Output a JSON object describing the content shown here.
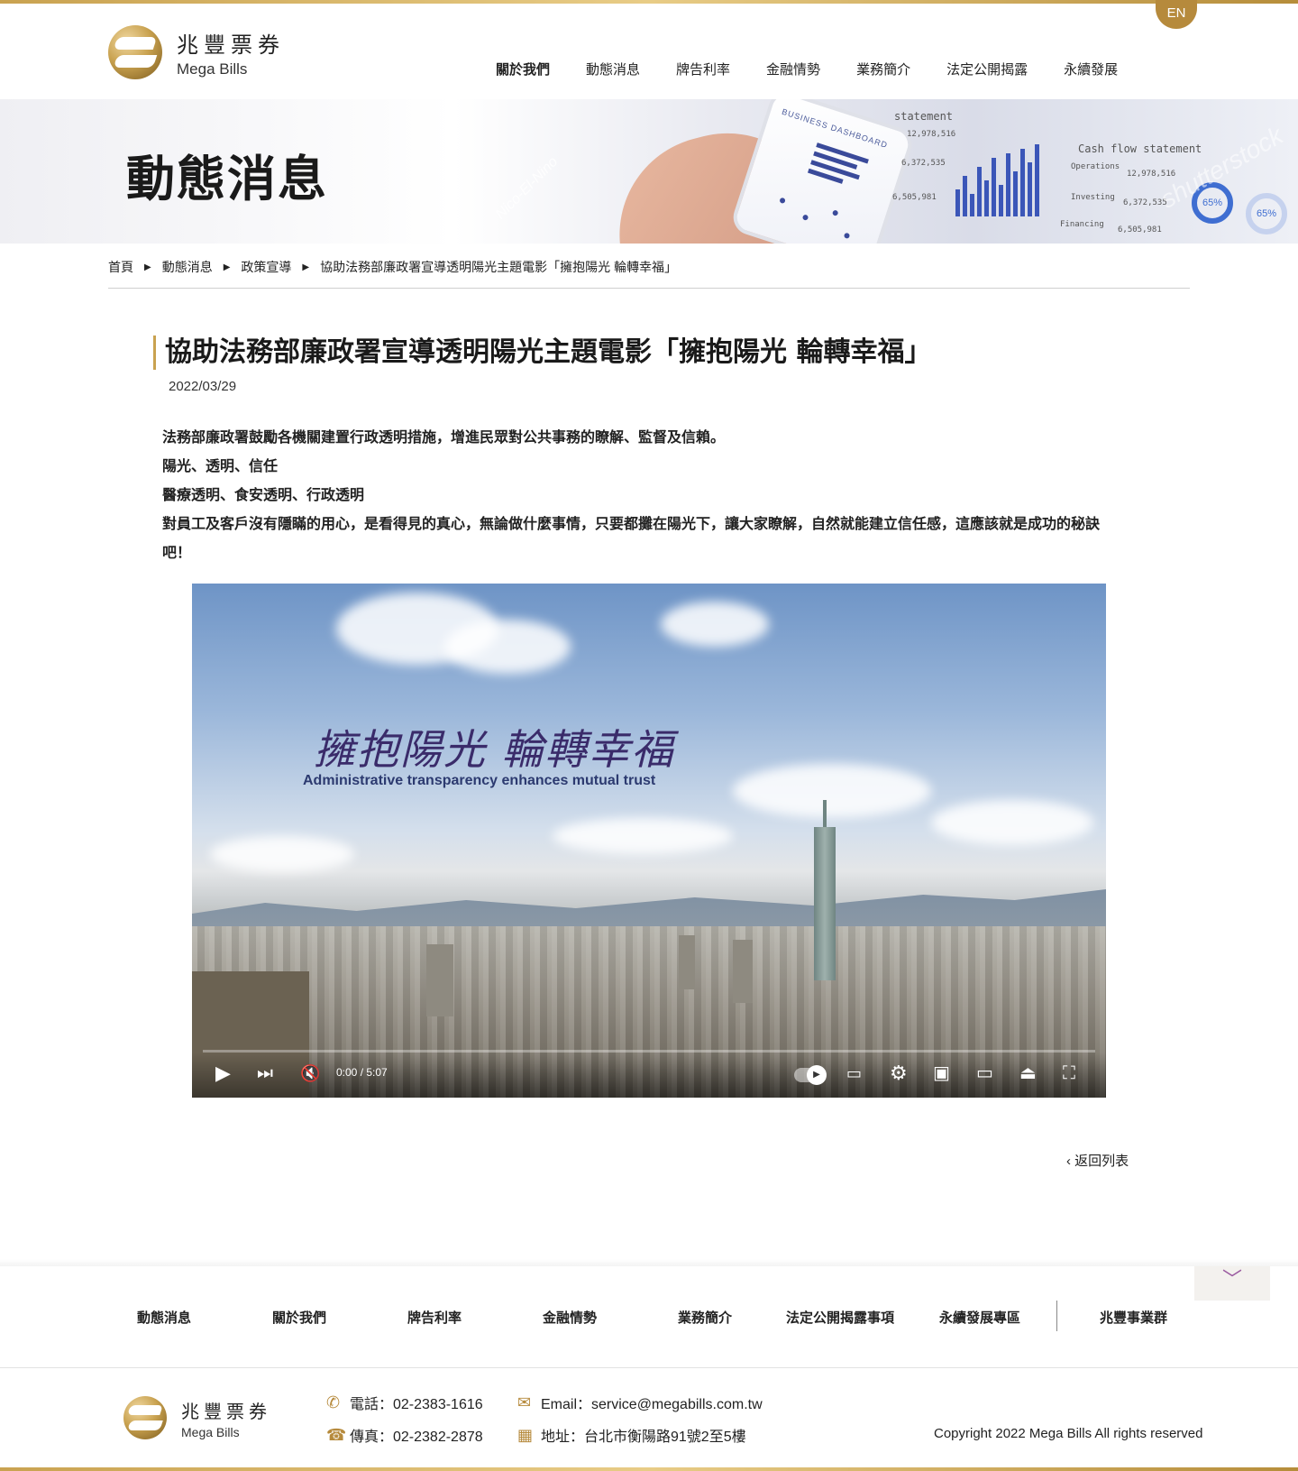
{
  "header": {
    "logo_zh": "兆豐票券",
    "logo_en": "Mega Bills",
    "lang_button": "EN",
    "nav": [
      {
        "label": "關於我們"
      },
      {
        "label": "動態消息"
      },
      {
        "label": "牌告利率"
      },
      {
        "label": "金融情勢"
      },
      {
        "label": "業務簡介"
      },
      {
        "label": "法定公開揭露"
      },
      {
        "label": "永續發展"
      }
    ]
  },
  "banner": {
    "title": "動態消息"
  },
  "breadcrumb": {
    "items": [
      "首頁",
      "動態消息",
      "政策宣導",
      "協助法務部廉政署宣導透明陽光主題電影「擁抱陽光 輪轉幸福」"
    ]
  },
  "article": {
    "title": "協助法務部廉政署宣導透明陽光主題電影「擁抱陽光 輪轉幸福」",
    "date": "2022/03/29",
    "paragraphs": [
      "法務部廉政署鼓勵各機關建置行政透明措施，增進民眾對公共事務的瞭解、監督及信賴。",
      "陽光、透明、信任",
      "醫療透明、食安透明、行政透明",
      "對員工及客戶沒有隱瞞的用心，是看得見的真心，無論做什麼事情，只要都攤在陽光下，讓大家瞭解，自然就能建立信任感，這應該就是成功的秘訣吧！"
    ]
  },
  "video": {
    "overlay_title": "擁抱陽光 輪轉幸福",
    "overlay_subtitle": "Administrative transparency enhances mutual trust",
    "time": "0:00 / 5:07",
    "icons": [
      "play-icon",
      "next-icon",
      "mute-icon",
      "autoplay-toggle",
      "subtitles-icon",
      "settings-icon",
      "miniplayer-icon",
      "theater-icon",
      "airplay-icon",
      "fullscreen-icon"
    ]
  },
  "back_link": "返回列表",
  "footer_nav": [
    {
      "label": "動態消息"
    },
    {
      "label": "關於我們"
    },
    {
      "label": "牌告利率"
    },
    {
      "label": "金融情勢"
    },
    {
      "label": "業務簡介"
    },
    {
      "label": "法定公開揭露事項"
    },
    {
      "label": "永續發展專區"
    },
    {
      "label": "兆豐事業群"
    }
  ],
  "footer": {
    "logo_zh": "兆豐票券",
    "logo_en": "Mega Bills",
    "phone": "電話：02-2383-1616",
    "fax": "傳真：02-2382-2878",
    "email": "Email：service@megabills.com.tw",
    "address": "地址：台北市衡陽路91號2至5樓",
    "copyright": "Copyright 2022 Mega Bills All rights reserved"
  },
  "colors": {
    "accent_gold": "#b68a3c",
    "collapse_arrow": "#9a5aa0"
  }
}
